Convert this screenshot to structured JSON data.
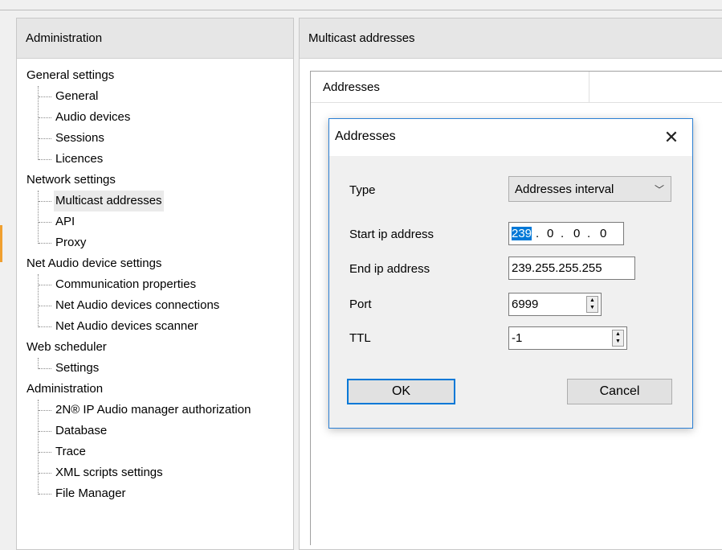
{
  "left_panel": {
    "title": "Administration",
    "tree": [
      {
        "label": "General settings",
        "children": [
          "General",
          "Audio devices",
          "Sessions",
          "Licences"
        ]
      },
      {
        "label": "Network settings",
        "children": [
          "Multicast addresses",
          "API",
          "Proxy"
        ]
      },
      {
        "label": "Net Audio device settings",
        "children": [
          "Communication properties",
          "Net Audio devices connections",
          "Net Audio devices scanner"
        ]
      },
      {
        "label": "Web scheduler",
        "children": [
          "Settings"
        ]
      },
      {
        "label": "Administration",
        "children": [
          "2N® IP Audio manager authorization",
          "Database",
          "Trace",
          "XML scripts settings",
          "File Manager"
        ]
      }
    ],
    "selected_item": "Multicast addresses"
  },
  "right_panel": {
    "title": "Multicast addresses",
    "grid_column": "Addresses"
  },
  "dialog": {
    "title": "Addresses",
    "close_glyph": "✕",
    "type_label": "Type",
    "type_value": "Addresses interval",
    "combo_arrow": "﹀",
    "start_label": "Start ip address",
    "start_ip": [
      "239",
      "0",
      "0",
      "0"
    ],
    "end_label": "End ip address",
    "end_ip": "239.255.255.255",
    "port_label": "Port",
    "port_value": "6999",
    "ttl_label": "TTL",
    "ttl_value": "-1",
    "ok_label": "OK",
    "cancel_label": "Cancel",
    "spin_up": "▲",
    "spin_down": "▼",
    "ip_dot": "."
  },
  "colors": {
    "accent": "#0078d7",
    "panel_header": "#e6e6e6",
    "dialog_border": "#2a7fd4"
  }
}
